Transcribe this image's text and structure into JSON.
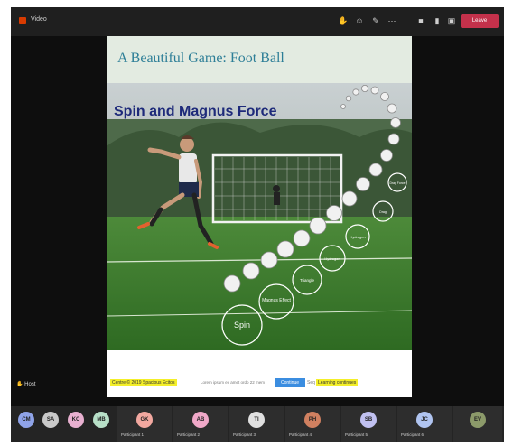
{
  "window": {
    "title": "Video"
  },
  "toolbar": {
    "leave_label": "Leave"
  },
  "slide": {
    "title": "A Beautiful Game: Foot Ball",
    "heading": "Spin and Magnus Force",
    "labels": [
      "Spin",
      "Magnus Effect",
      "Triangle",
      "Hydrogen",
      "Hydrogen",
      "Drag",
      "Drag Force"
    ]
  },
  "caption": {
    "left_highlight": "Centre © 2019 Spacious Ecitos",
    "mid_text": "Lorem ipsum ex amet ordo 22 mem",
    "button": "Continue",
    "gray_text": "Seq",
    "right_highlight": "Learning continues"
  },
  "presenter": {
    "name": "Host"
  },
  "participants": [
    {
      "initials": "CM",
      "color": "#8fa3e8",
      "label": ""
    },
    {
      "initials": "SA",
      "color": "#c9c9c9",
      "label": ""
    },
    {
      "initials": "KC",
      "color": "#e8b0d0",
      "label": ""
    },
    {
      "initials": "MB",
      "color": "#b8e0c8",
      "label": ""
    },
    {
      "initials": "GK",
      "color": "#f2a8a0",
      "label": "Participant 1"
    },
    {
      "initials": "AB",
      "color": "#f0a8c8",
      "label": "Participant 2"
    },
    {
      "initials": "TI",
      "color": "#e0e0e0",
      "label": "Participant 3"
    },
    {
      "initials": "PH",
      "color": "#d08060",
      "label": "Participant 4"
    },
    {
      "initials": "SB",
      "color": "#c0c0f0",
      "label": "Participant 5"
    },
    {
      "initials": "JC",
      "color": "#b0c4f0",
      "label": "Participant 6"
    },
    {
      "initials": "EV",
      "color": "#8c9a6a",
      "label": ""
    }
  ]
}
